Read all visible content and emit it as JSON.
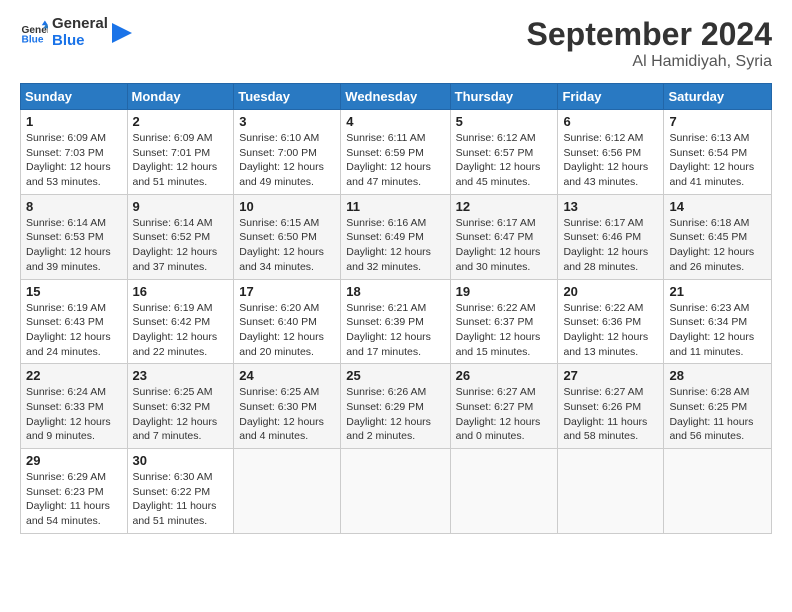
{
  "header": {
    "logo_line1": "General",
    "logo_line2": "Blue",
    "month_title": "September 2024",
    "location": "Al Hamidiyah, Syria"
  },
  "weekdays": [
    "Sunday",
    "Monday",
    "Tuesday",
    "Wednesday",
    "Thursday",
    "Friday",
    "Saturday"
  ],
  "weeks": [
    [
      {
        "day": "1",
        "sunrise": "6:09 AM",
        "sunset": "7:03 PM",
        "daylight": "12 hours and 53 minutes."
      },
      {
        "day": "2",
        "sunrise": "6:09 AM",
        "sunset": "7:01 PM",
        "daylight": "12 hours and 51 minutes."
      },
      {
        "day": "3",
        "sunrise": "6:10 AM",
        "sunset": "7:00 PM",
        "daylight": "12 hours and 49 minutes."
      },
      {
        "day": "4",
        "sunrise": "6:11 AM",
        "sunset": "6:59 PM",
        "daylight": "12 hours and 47 minutes."
      },
      {
        "day": "5",
        "sunrise": "6:12 AM",
        "sunset": "6:57 PM",
        "daylight": "12 hours and 45 minutes."
      },
      {
        "day": "6",
        "sunrise": "6:12 AM",
        "sunset": "6:56 PM",
        "daylight": "12 hours and 43 minutes."
      },
      {
        "day": "7",
        "sunrise": "6:13 AM",
        "sunset": "6:54 PM",
        "daylight": "12 hours and 41 minutes."
      }
    ],
    [
      {
        "day": "8",
        "sunrise": "6:14 AM",
        "sunset": "6:53 PM",
        "daylight": "12 hours and 39 minutes."
      },
      {
        "day": "9",
        "sunrise": "6:14 AM",
        "sunset": "6:52 PM",
        "daylight": "12 hours and 37 minutes."
      },
      {
        "day": "10",
        "sunrise": "6:15 AM",
        "sunset": "6:50 PM",
        "daylight": "12 hours and 34 minutes."
      },
      {
        "day": "11",
        "sunrise": "6:16 AM",
        "sunset": "6:49 PM",
        "daylight": "12 hours and 32 minutes."
      },
      {
        "day": "12",
        "sunrise": "6:17 AM",
        "sunset": "6:47 PM",
        "daylight": "12 hours and 30 minutes."
      },
      {
        "day": "13",
        "sunrise": "6:17 AM",
        "sunset": "6:46 PM",
        "daylight": "12 hours and 28 minutes."
      },
      {
        "day": "14",
        "sunrise": "6:18 AM",
        "sunset": "6:45 PM",
        "daylight": "12 hours and 26 minutes."
      }
    ],
    [
      {
        "day": "15",
        "sunrise": "6:19 AM",
        "sunset": "6:43 PM",
        "daylight": "12 hours and 24 minutes."
      },
      {
        "day": "16",
        "sunrise": "6:19 AM",
        "sunset": "6:42 PM",
        "daylight": "12 hours and 22 minutes."
      },
      {
        "day": "17",
        "sunrise": "6:20 AM",
        "sunset": "6:40 PM",
        "daylight": "12 hours and 20 minutes."
      },
      {
        "day": "18",
        "sunrise": "6:21 AM",
        "sunset": "6:39 PM",
        "daylight": "12 hours and 17 minutes."
      },
      {
        "day": "19",
        "sunrise": "6:22 AM",
        "sunset": "6:37 PM",
        "daylight": "12 hours and 15 minutes."
      },
      {
        "day": "20",
        "sunrise": "6:22 AM",
        "sunset": "6:36 PM",
        "daylight": "12 hours and 13 minutes."
      },
      {
        "day": "21",
        "sunrise": "6:23 AM",
        "sunset": "6:34 PM",
        "daylight": "12 hours and 11 minutes."
      }
    ],
    [
      {
        "day": "22",
        "sunrise": "6:24 AM",
        "sunset": "6:33 PM",
        "daylight": "12 hours and 9 minutes."
      },
      {
        "day": "23",
        "sunrise": "6:25 AM",
        "sunset": "6:32 PM",
        "daylight": "12 hours and 7 minutes."
      },
      {
        "day": "24",
        "sunrise": "6:25 AM",
        "sunset": "6:30 PM",
        "daylight": "12 hours and 4 minutes."
      },
      {
        "day": "25",
        "sunrise": "6:26 AM",
        "sunset": "6:29 PM",
        "daylight": "12 hours and 2 minutes."
      },
      {
        "day": "26",
        "sunrise": "6:27 AM",
        "sunset": "6:27 PM",
        "daylight": "12 hours and 0 minutes."
      },
      {
        "day": "27",
        "sunrise": "6:27 AM",
        "sunset": "6:26 PM",
        "daylight": "11 hours and 58 minutes."
      },
      {
        "day": "28",
        "sunrise": "6:28 AM",
        "sunset": "6:25 PM",
        "daylight": "11 hours and 56 minutes."
      }
    ],
    [
      {
        "day": "29",
        "sunrise": "6:29 AM",
        "sunset": "6:23 PM",
        "daylight": "11 hours and 54 minutes."
      },
      {
        "day": "30",
        "sunrise": "6:30 AM",
        "sunset": "6:22 PM",
        "daylight": "11 hours and 51 minutes."
      },
      null,
      null,
      null,
      null,
      null
    ]
  ]
}
